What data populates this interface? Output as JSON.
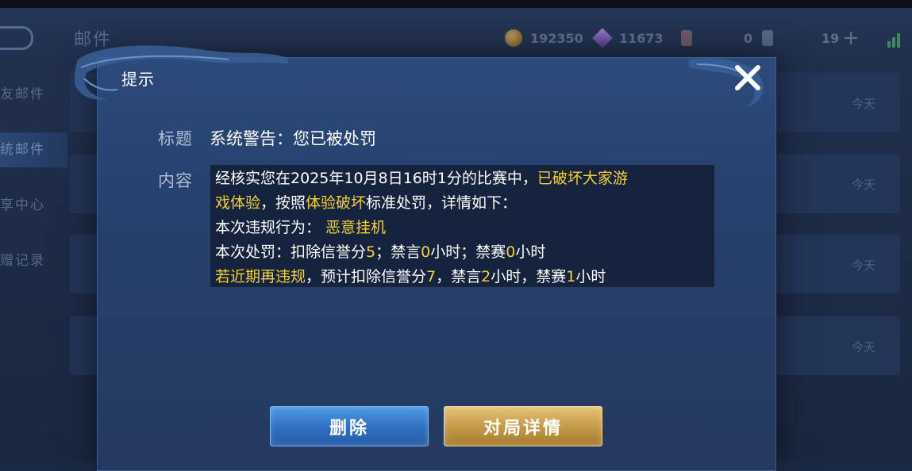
{
  "header": {
    "title": "邮件",
    "coins": "192350",
    "gems": "11673",
    "tickets": "0",
    "stamina": "19"
  },
  "sidebar": {
    "items": [
      {
        "label": "友邮件"
      },
      {
        "label": "统邮件"
      },
      {
        "label": "享中心"
      },
      {
        "label": "赠记录"
      }
    ]
  },
  "mail_list": {
    "dates": [
      "今天",
      "今天",
      "今天",
      "今天"
    ]
  },
  "dialog": {
    "title": "提示",
    "subject_label": "标题",
    "subject_value": "系统警告：您已被处罚",
    "content_label": "内容",
    "content": {
      "l1_a": "经核实您在2025年10月8日16时1分的比赛中，",
      "l1_b": "已破坏大家游",
      "l2_a": "戏体验",
      "l2_b": "，按照",
      "l2_c": "体验破坏",
      "l2_d": "标准处罚，详情如下：",
      "l3_a": "本次违规行为：",
      "l3_b": "恶意挂机",
      "l4_a": "本次处罚：扣除信誉分",
      "l4_b": "5",
      "l4_c": "；禁言",
      "l4_d": "0",
      "l4_e": "小时；禁赛",
      "l4_f": "0",
      "l4_g": "小时",
      "l5_a": "若近期再违规",
      "l5_b": "，预计扣除信誉分",
      "l5_c": "7",
      "l5_d": "，禁言",
      "l5_e": "2",
      "l5_f": "小时，禁赛",
      "l5_g": "1",
      "l5_h": "小时"
    },
    "delete_button": "删除",
    "details_button": "对局详情"
  },
  "colors": {
    "highlight": "#f5d130",
    "dialog_bg": "#2c4a7b",
    "delete_btn": "#2f6fc0",
    "details_btn": "#c39845"
  }
}
